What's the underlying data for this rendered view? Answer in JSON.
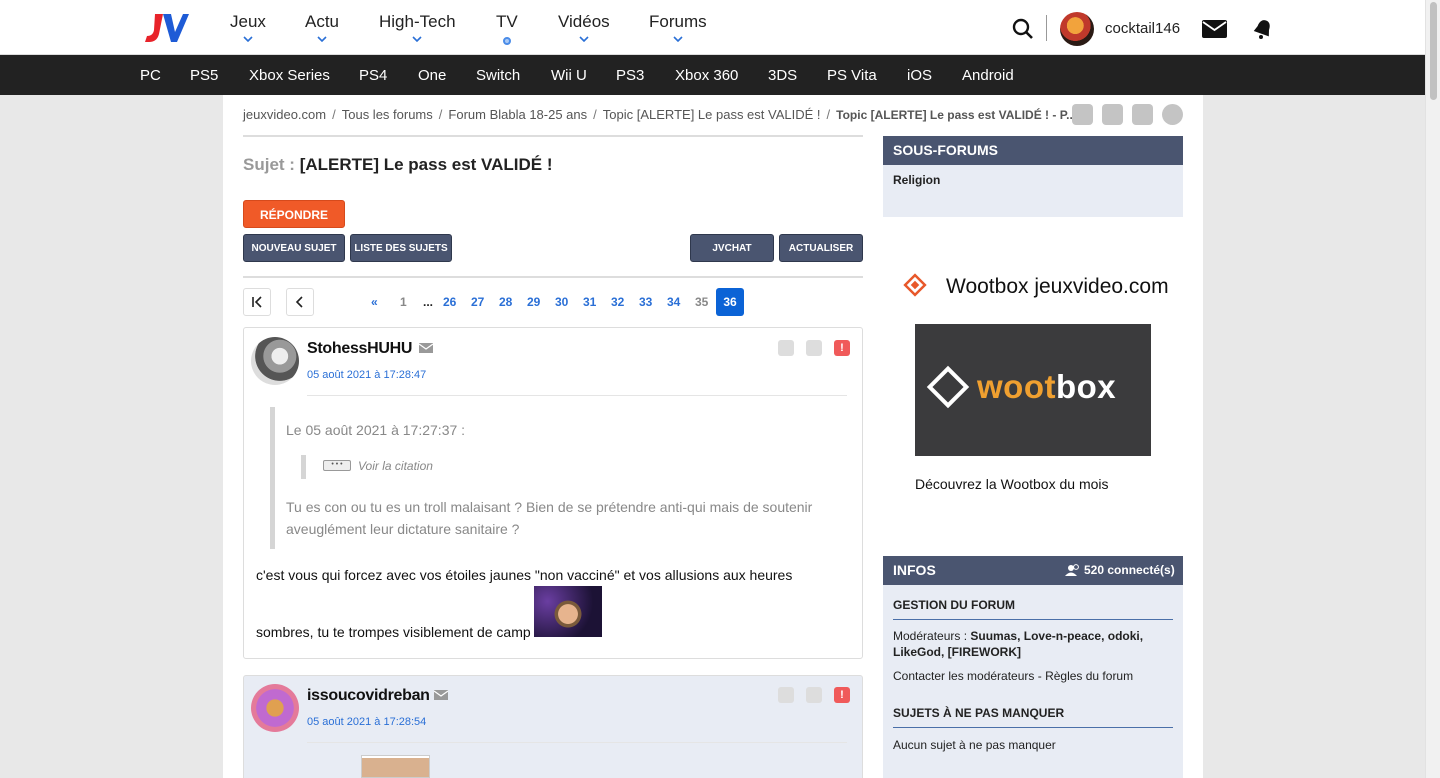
{
  "header": {
    "nav": [
      {
        "label": "Jeux"
      },
      {
        "label": "Actu"
      },
      {
        "label": "High-Tech"
      },
      {
        "label": "TV"
      },
      {
        "label": "Vidéos"
      },
      {
        "label": "Forums"
      }
    ],
    "username": "cocktail146"
  },
  "platforms": [
    "PC",
    "PS5",
    "Xbox Series",
    "PS4",
    "One",
    "Switch",
    "Wii U",
    "PS3",
    "Xbox 360",
    "3DS",
    "PS Vita",
    "iOS",
    "Android"
  ],
  "breadcrumb": {
    "items": [
      "jeuxvideo.com",
      "Tous les forums",
      "Forum Blabla 18-25 ans",
      "Topic [ALERTE] Le pass est VALIDÉ !"
    ],
    "current": "Topic [ALERTE] Le pass est VALIDÉ ! - P..."
  },
  "topic": {
    "subject_label": "Sujet :",
    "subject_title": "[ALERTE] Le pass est VALIDÉ !"
  },
  "buttons": {
    "reply": "RÉPONDRE",
    "new_topic": "NOUVEAU SUJET",
    "topic_list": "LISTE DES SUJETS",
    "jvchat": "JVCHAT",
    "refresh": "ACTUALISER"
  },
  "pagination": {
    "prev_marker": "«",
    "pages": [
      "1",
      "...",
      "26",
      "27",
      "28",
      "29",
      "30",
      "31",
      "32",
      "33",
      "34",
      "35",
      "36"
    ],
    "current_page": "36"
  },
  "posts": [
    {
      "author": "StohessHUHU",
      "date": "05 août 2021 à 17:28:47",
      "quote_header": "Le 05 août 2021 à 17:27:37 :",
      "subquote_text": "Voir la citation",
      "quote_body": "Tu es con ou tu es un troll malaisant ? Bien de se prétendre anti-qui mais de soutenir aveuglément leur dictature sanitaire ?",
      "body_line1": "c'est vous qui forcez avec vos étoiles jaunes \"non vacciné\" et vos allusions aux heures",
      "body_line2": "sombres, tu te trompes visiblement de camp"
    },
    {
      "author": "issoucovidreban",
      "date": "05 août 2021 à 17:28:54"
    }
  ],
  "sidebar": {
    "sous_forums": {
      "title": "SOUS-FORUMS",
      "items": [
        "Religion"
      ]
    },
    "wootbox": {
      "title": "Wootbox jeuxvideo.com",
      "wordmark_a": "woot",
      "wordmark_b": "box",
      "caption": "Découvrez la Wootbox du mois"
    },
    "infos": {
      "title": "INFOS",
      "connected": "520 connecté(s)",
      "gestion_title": "GESTION DU FORUM",
      "moderators_label": "Modérateurs :",
      "moderators": "Suumas, Love-n-peace, odoki, LikeGod, [FIREWORK]",
      "contact": "Contacter les modérateurs - Règles du forum",
      "sujets_title": "SUJETS À NE PAS MANQUER",
      "sujets_empty": "Aucun sujet à ne pas manquer"
    }
  },
  "colors": {
    "accent_red": "#f05a28",
    "panel_header": "#4a5570",
    "link_blue": "#2a6fd6",
    "platform_bar": "#222222"
  }
}
